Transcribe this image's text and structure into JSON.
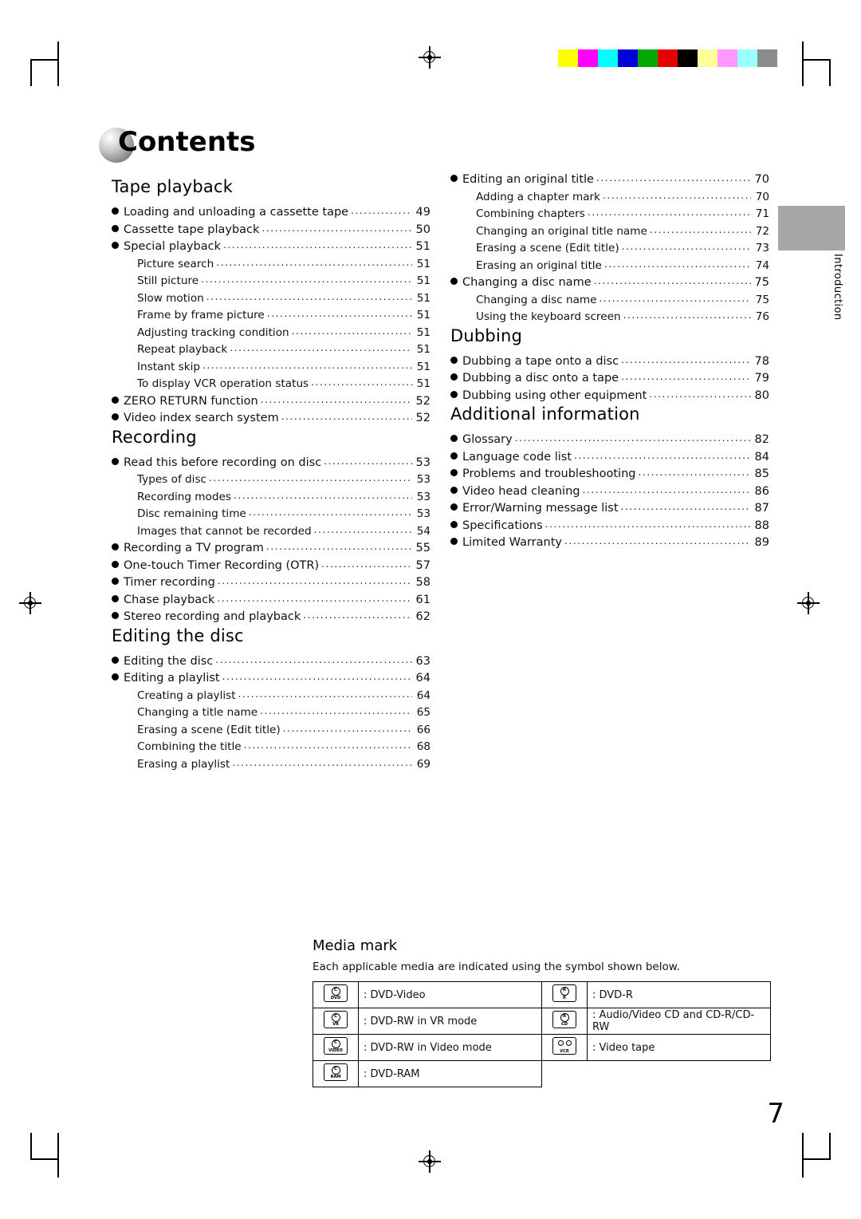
{
  "document": {
    "title": "Contents",
    "page_number": "7",
    "side_tab_label": "Introduction"
  },
  "colorbar": [
    "#ffff00",
    "#ff00ff",
    "#00ffff",
    "#0000d8",
    "#00a800",
    "#e60000",
    "#000000",
    "#ffff99",
    "#ff99ff",
    "#99ffff",
    "#8c8c8c"
  ],
  "left_column": [
    {
      "heading": "Tape playback",
      "entries": [
        {
          "level": "main",
          "text": "Loading and unloading a cassette tape",
          "page": "49"
        },
        {
          "level": "main",
          "text": "Cassette tape playback",
          "page": "50"
        },
        {
          "level": "main",
          "text": "Special playback",
          "page": "51"
        },
        {
          "level": "sub",
          "text": "Picture search",
          "page": "51"
        },
        {
          "level": "sub",
          "text": "Still picture",
          "page": "51"
        },
        {
          "level": "sub",
          "text": "Slow motion",
          "page": "51"
        },
        {
          "level": "sub",
          "text": "Frame by frame picture",
          "page": "51"
        },
        {
          "level": "sub",
          "text": "Adjusting tracking condition",
          "page": "51"
        },
        {
          "level": "sub",
          "text": "Repeat playback",
          "page": "51"
        },
        {
          "level": "sub",
          "text": "Instant skip",
          "page": "51"
        },
        {
          "level": "sub",
          "text": "To display VCR operation status",
          "page": "51"
        },
        {
          "level": "main",
          "text": "ZERO RETURN function",
          "page": "52"
        },
        {
          "level": "main",
          "text": "Video index search system",
          "page": "52"
        }
      ]
    },
    {
      "heading": "Recording",
      "entries": [
        {
          "level": "main",
          "text": "Read this before recording on disc",
          "page": "53"
        },
        {
          "level": "sub",
          "text": "Types of disc",
          "page": "53"
        },
        {
          "level": "sub",
          "text": "Recording modes",
          "page": "53"
        },
        {
          "level": "sub",
          "text": "Disc remaining time",
          "page": "53"
        },
        {
          "level": "sub",
          "text": "Images that cannot be recorded",
          "page": "54"
        },
        {
          "level": "main",
          "text": "Recording a TV program",
          "page": "55"
        },
        {
          "level": "main",
          "text": "One-touch Timer Recording (OTR)",
          "page": "57"
        },
        {
          "level": "main",
          "text": "Timer recording",
          "page": "58"
        },
        {
          "level": "main",
          "text": "Chase playback",
          "page": "61"
        },
        {
          "level": "main",
          "text": "Stereo recording and playback",
          "page": "62"
        }
      ]
    },
    {
      "heading": "Editing the disc",
      "entries": [
        {
          "level": "main",
          "text": "Editing the disc",
          "page": "63"
        },
        {
          "level": "main",
          "text": "Editing a playlist",
          "page": "64"
        },
        {
          "level": "sub",
          "text": "Creating a playlist",
          "page": "64"
        },
        {
          "level": "sub",
          "text": "Changing a title name",
          "page": "65"
        },
        {
          "level": "sub",
          "text": "Erasing a scene (Edit title)",
          "page": "66"
        },
        {
          "level": "sub",
          "text": "Combining the title",
          "page": "68"
        },
        {
          "level": "sub",
          "text": "Erasing a playlist",
          "page": "69"
        }
      ]
    }
  ],
  "right_column": [
    {
      "heading": "",
      "entries": [
        {
          "level": "main",
          "text": "Editing an original title",
          "page": "70"
        },
        {
          "level": "sub",
          "text": "Adding a chapter mark",
          "page": "70"
        },
        {
          "level": "sub",
          "text": "Combining chapters",
          "page": "71"
        },
        {
          "level": "sub",
          "text": "Changing an original title name",
          "page": "72"
        },
        {
          "level": "sub",
          "text": "Erasing a scene (Edit title)",
          "page": "73"
        },
        {
          "level": "sub",
          "text": "Erasing an original title",
          "page": "74"
        },
        {
          "level": "main",
          "text": "Changing a disc name",
          "page": "75"
        },
        {
          "level": "sub",
          "text": "Changing a disc name",
          "page": "75"
        },
        {
          "level": "sub",
          "text": "Using the keyboard screen",
          "page": "76"
        }
      ]
    },
    {
      "heading": "Dubbing",
      "entries": [
        {
          "level": "main",
          "text": "Dubbing a tape onto a disc",
          "page": "78"
        },
        {
          "level": "main",
          "text": "Dubbing a disc onto a tape",
          "page": "79"
        },
        {
          "level": "main",
          "text": "Dubbing using other equipment",
          "page": "80"
        }
      ]
    },
    {
      "heading": "Additional information",
      "entries": [
        {
          "level": "main",
          "text": "Glossary",
          "page": "82"
        },
        {
          "level": "main",
          "text": "Language code list",
          "page": "84"
        },
        {
          "level": "main",
          "text": "Problems and troubleshooting",
          "page": "85"
        },
        {
          "level": "main",
          "text": "Video head cleaning",
          "page": "86"
        },
        {
          "level": "main",
          "text": "Error/Warning message list",
          "page": "87"
        },
        {
          "level": "main",
          "text": "Specifications",
          "page": "88"
        },
        {
          "level": "main",
          "text": "Limited Warranty",
          "page": "89"
        }
      ]
    }
  ],
  "media_mark": {
    "heading": "Media mark",
    "description": "Each applicable media are indicated using the symbol shown below.",
    "rows": [
      {
        "left": {
          "icon": "dvd-video-icon",
          "icon_top": "C",
          "icon_bottom": "DVD",
          "label": ": DVD-Video"
        },
        "right": {
          "icon": "dvd-r-icon",
          "icon_top": "R",
          "icon_bottom": "R",
          "label": ": DVD-R"
        }
      },
      {
        "left": {
          "icon": "dvd-rw-vr-icon",
          "icon_top": "C",
          "icon_bottom": "VR",
          "label": ": DVD-RW in VR mode"
        },
        "right": {
          "icon": "audio-video-cd-icon",
          "icon_top": "R",
          "icon_bottom": "CD",
          "label": ": Audio/Video CD and CD-R/CD-RW"
        }
      },
      {
        "left": {
          "icon": "dvd-rw-video-icon",
          "icon_top": "C",
          "icon_bottom": "VIDEO",
          "label": ": DVD-RW in Video mode"
        },
        "right": {
          "icon": "video-tape-icon",
          "icon_top": "",
          "icon_bottom": "VCR",
          "label": ": Video tape"
        }
      },
      {
        "left": {
          "icon": "dvd-ram-icon",
          "icon_top": "C",
          "icon_bottom": "RAM",
          "label": ": DVD-RAM"
        },
        "right": null
      }
    ]
  }
}
